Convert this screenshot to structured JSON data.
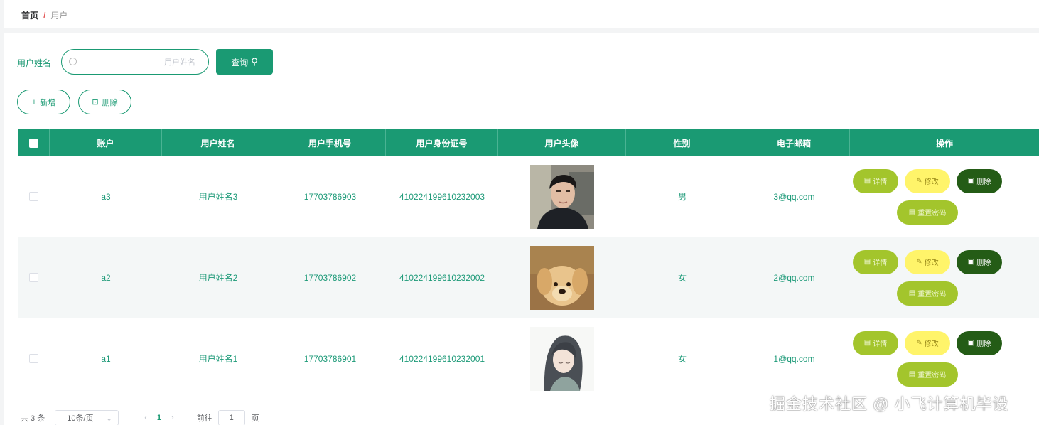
{
  "breadcrumb": {
    "home": "首页",
    "separator": "/",
    "current": "用户"
  },
  "search": {
    "label": "用户姓名",
    "placeholder": "用户姓名",
    "value": "",
    "button_label": "查询"
  },
  "actions": {
    "add_label": "新增",
    "delete_label": "删除"
  },
  "table": {
    "columns": [
      "账户",
      "用户姓名",
      "用户手机号",
      "用户身份证号",
      "用户头像",
      "性别",
      "电子邮箱",
      "操作"
    ],
    "rows": [
      {
        "account": "a3",
        "name": "用户姓名3",
        "phone": "17703786903",
        "id_card": "410224199610232003",
        "avatar": "avatar-young-man",
        "gender": "男",
        "email": "3@qq.com"
      },
      {
        "account": "a2",
        "name": "用户姓名2",
        "phone": "17703786902",
        "id_card": "410224199610232002",
        "avatar": "avatar-puppy",
        "gender": "女",
        "email": "2@qq.com"
      },
      {
        "account": "a1",
        "name": "用户姓名1",
        "phone": "17703786901",
        "id_card": "410224199610232001",
        "avatar": "avatar-anime-girl",
        "gender": "女",
        "email": "1@qq.com"
      }
    ],
    "row_actions": {
      "detail": "详情",
      "edit": "修改",
      "delete": "删除",
      "reset_password": "重置密码"
    }
  },
  "pagination": {
    "total_text": "共 3 条",
    "page_size": "10条/页",
    "current_page": "1",
    "goto_label": "前往",
    "goto_value": "1",
    "page_suffix": "页"
  },
  "watermark": "掘金技术社区 @ 小飞计算机毕设",
  "colors": {
    "primary": "#1a9a73",
    "detail": "#a3c52c",
    "edit": "#fff46a",
    "delete": "#245c16"
  }
}
